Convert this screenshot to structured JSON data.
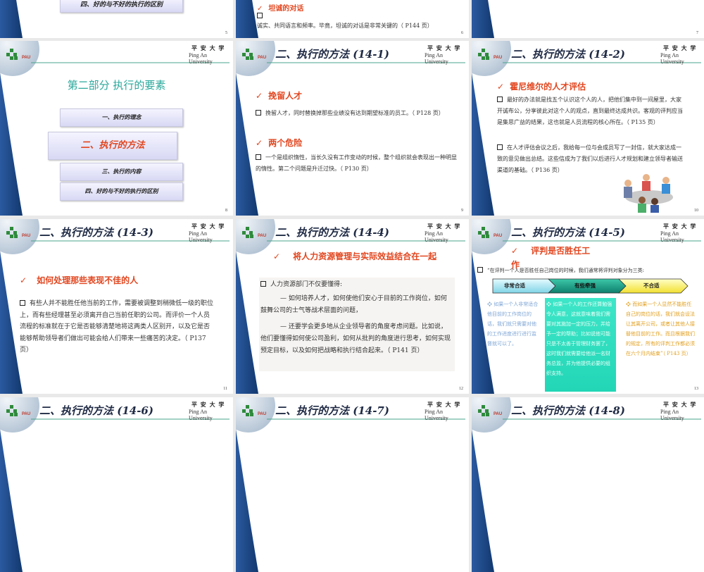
{
  "header": {
    "univ_cn": "平 安 大 学",
    "univ_en_1": "Ping An",
    "univ_en_2": "University",
    "logo_text": "PAU"
  },
  "slides": {
    "s5": {
      "number": "5",
      "box": "四、好的与不好的执行的区别"
    },
    "s6": {
      "number": "6",
      "heading": "坦诚的对话",
      "text": "诚实、共同语言和频率。毕竟，坦诚的对话是非常关键的（ P144 页）"
    },
    "s7": {
      "number": "7"
    },
    "s8": {
      "number": "8",
      "title": "第二部分  执行的要素",
      "items": [
        "一、执行的理念",
        "二、执行的方法",
        "三、执行的内容",
        "四、好的与不好的执行的区别"
      ]
    },
    "s9": {
      "number": "9",
      "title": "二、执行的方法 (14-1)",
      "heading1": "挽留人才",
      "text1": "挽留人才，同时替换掉那些业绩没有达到期望标准的员工。（ P128 页）",
      "heading2": "两个危险",
      "text2": "一个是组织惰性，当长久没有工作变动的时候，整个组织就会表现出一种明显的惰性。第二个问题是升迁过快。（ P130 页）"
    },
    "s10": {
      "number": "10",
      "title": "二、执行的方法 (14-2)",
      "heading": "霍尼维尔的人才评估",
      "text1": "最好的办法就是找五个认识这个人的人，把他们集中到一间屋里，大家开诚布公，分享彼此对这个人的观点，直到最终达成共识。客观的评判应当是集思广益的结果，这也就是人员流程的核心所在。（ P135 页）",
      "text2": "在人才评估会议之后，我给每一位与会成员写了一封信，就大家达成一致的意见做出总结。这些信成为了我们以后进行人才规划和建立领导者输送渠道的基础。（ P136 页）"
    },
    "s11": {
      "number": "11",
      "title": "二、执行的方法 (14-3)",
      "heading": "如何处理那些表现不佳的人",
      "text": "有些人并不能胜任他当前的工作，需要被调整到稍微低一级的职位上，而有些经理甚至必须离开自己当前任职的公司。而评价一个人员流程的标准就在于它是否能够清楚地将这两类人区别开，以及它是否能够帮助领导者们做出可能会给人们带来一些痛苦的决定。（ P137 页）"
    },
    "s12": {
      "number": "12",
      "title": "二、执行的方法 (14-4)",
      "heading": "将人力资源管理与实际效益结合在一起",
      "intro": "人力资源部门不仅要懂得:",
      "para1": "— 如何培养人才，如何使他们安心于目前的工作岗位，如何鼓舞公司的士气等战术层面的问题，",
      "para2": "— 还要学会更多地从企业领导者的角度考虑问题。比如说，他们要懂得如何使公司盈利，如何从批判的角度进行思考，如何实现预定目标，以及如何把战略和执行结合起来。（ P141 页）"
    },
    "s13": {
      "number": "13",
      "title": "二、执行的方法 (14-5)",
      "heading": "评判是否胜任工作",
      "intro": "“在评判一个人是否胜任自己岗位的时候，我们通常将评判对象分为三类:",
      "stages": [
        "非常合适",
        "有些牵强",
        "不合适"
      ],
      "col1": "如果一个人非常适合他目前的工作岗位的话，我们就只需要对他的工作进度进行进行监督就可以了。",
      "col2": "如果一个人的工作还算勉强令人满意，这就意味着我们需要对其施加一定的压力，并给予一定的帮助；比如说他可能只是不太善于管理财务罢了，这时我们就需要给他派一名财务总监，并为他提供必要的组织支持。",
      "col3": "而如果一个人显然不能胜任自己的岗位的话，我们就会设法让其离开公司，或者让其他人接替他目前的工作。而且根据我们的规定，所有的评判工作都必须在六个月内结束”（ P143 页）"
    },
    "s14": {
      "title": "二、执行的方法 (14-6)"
    },
    "s15": {
      "title": "二、执行的方法 (14-7)"
    },
    "s16": {
      "title": "二、执行的方法 (14-8)"
    }
  },
  "colors": {
    "accent_red": "#e2461f",
    "teal_title": "#2aa79b",
    "sidebar_blue": "#1d4a8c"
  }
}
